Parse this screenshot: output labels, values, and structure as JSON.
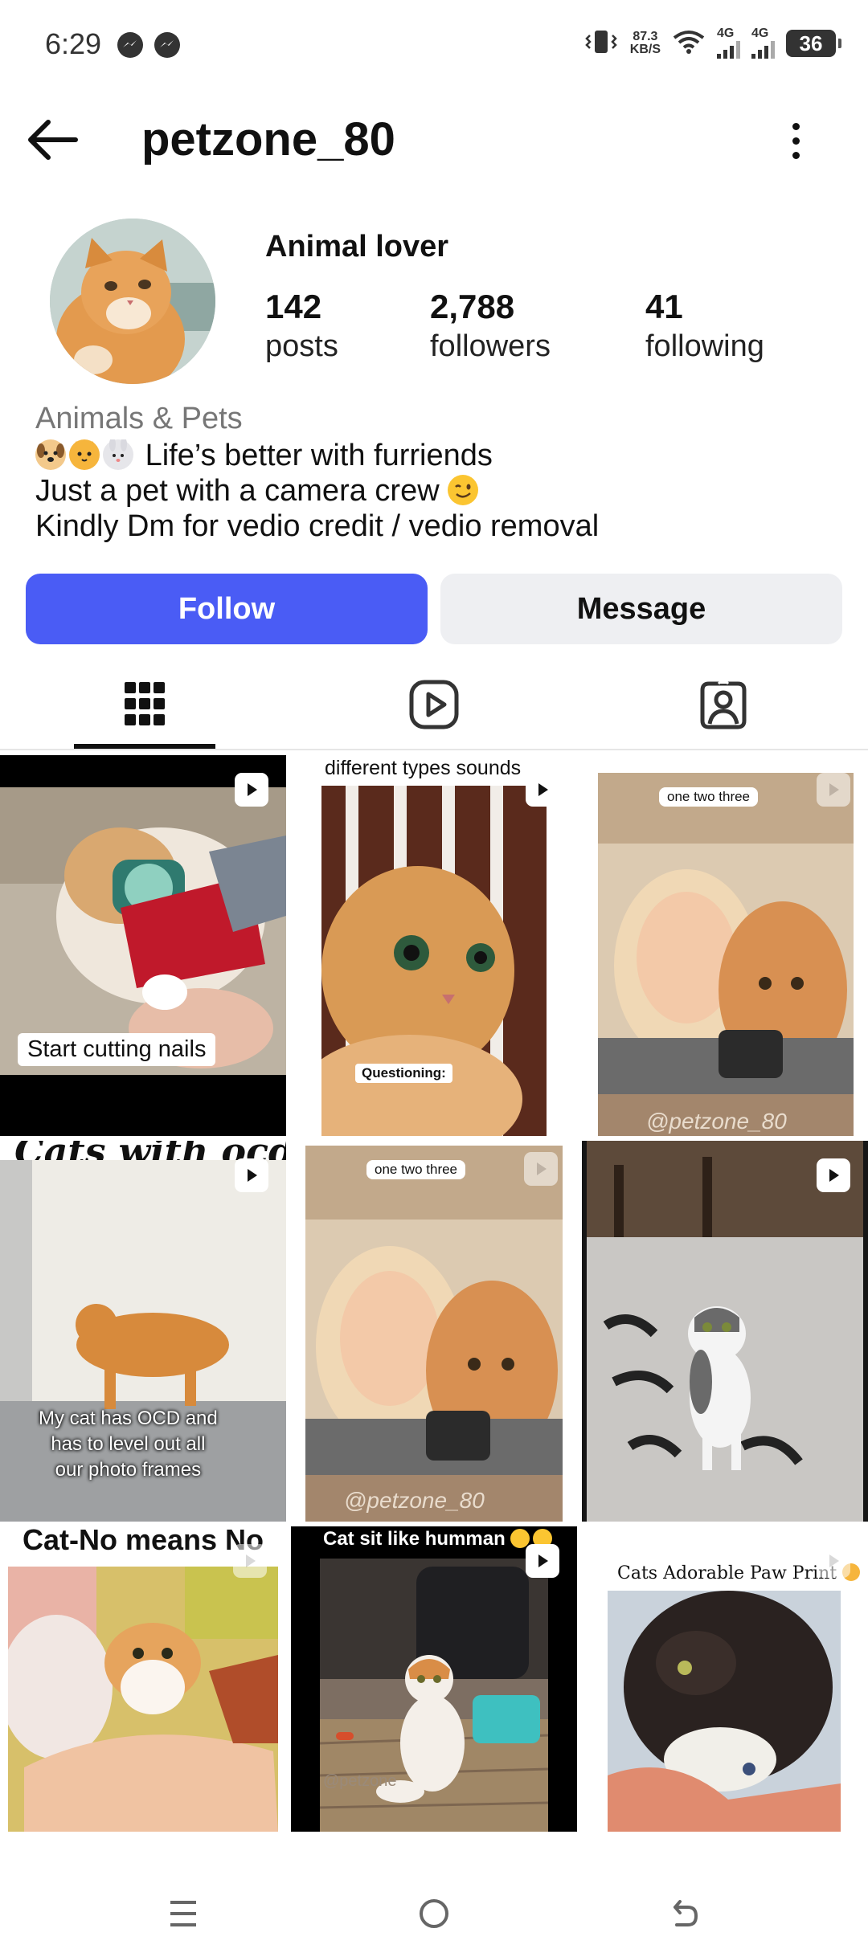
{
  "status_bar": {
    "time": "6:29",
    "net_speed_value": "87.3",
    "net_speed_unit": "KB/S",
    "network_1": "4G",
    "network_2": "4G",
    "battery": "36"
  },
  "header": {
    "username": "petzone_80"
  },
  "profile": {
    "display_name": "Animal lover",
    "stats": {
      "posts": {
        "value": "142",
        "label": "posts"
      },
      "followers": {
        "value": "2,788",
        "label": "followers"
      },
      "following": {
        "value": "41",
        "label": "following"
      }
    },
    "category": "Animals & Pets",
    "bio": {
      "line1": "Life’s better with furriends",
      "line2": "Just a pet with a camera crew",
      "line3": "Kindly Dm for vedio credit / vedio removal"
    }
  },
  "actions": {
    "follow_label": "Follow",
    "message_label": "Message"
  },
  "tabs": [
    "grid-icon",
    "reels-icon",
    "tagged-icon"
  ],
  "posts": [
    {
      "caption": "Start cutting nails"
    },
    {
      "top_text": "different types sounds",
      "caption": "Questioning:"
    },
    {
      "sticker": "one two three",
      "watermark": "@petzone_80"
    },
    {
      "top_text": "Cats with ocd",
      "caption1": "My cat has OCD and",
      "caption2": "has to level out all",
      "caption3": "our photo frames"
    },
    {
      "sticker": "one two three",
      "watermark": "@petzone_80"
    },
    {
      "caption": ""
    },
    {
      "top_text": "Cat-No means No"
    },
    {
      "top_text": "Cat sit like humman",
      "watermark": "@petzone"
    },
    {
      "top_text": "Cats Adorable Paw Print"
    }
  ],
  "colors": {
    "follow_button": "#4a5cf5",
    "message_button": "#eeeff2"
  }
}
